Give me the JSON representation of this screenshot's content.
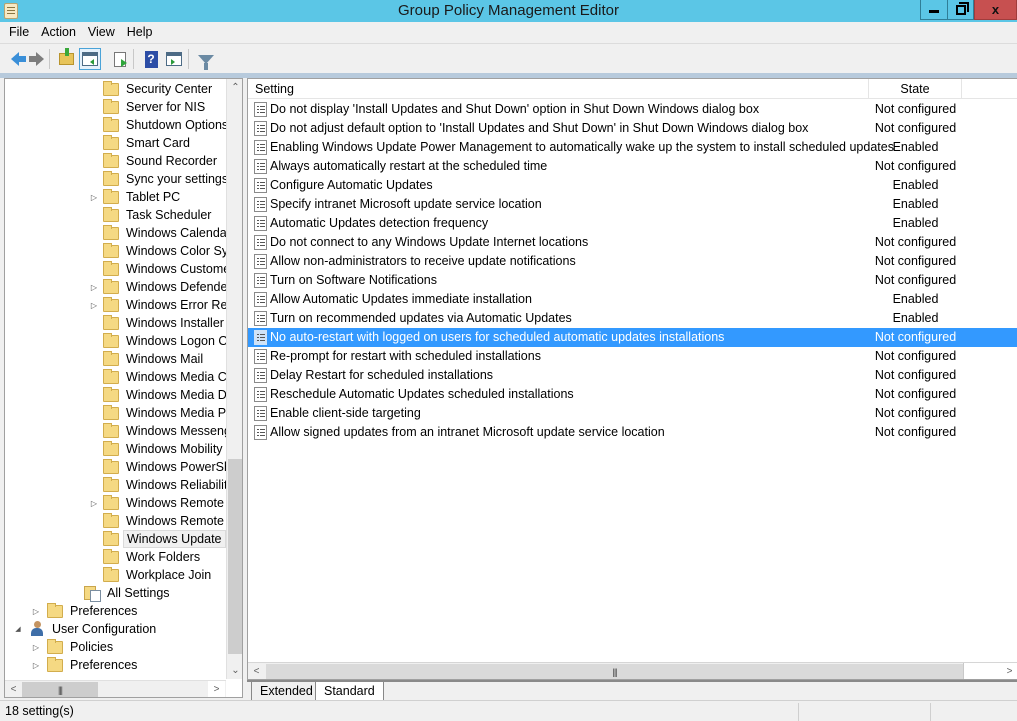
{
  "window": {
    "title": "Group Policy Management Editor",
    "controls": {
      "minimize": "minimize",
      "restore": "restore",
      "close": "x"
    }
  },
  "menu": [
    "File",
    "Action",
    "View",
    "Help"
  ],
  "toolbar": {
    "buttons": [
      "back-icon",
      "forward-icon",
      "up-one-level-icon",
      "show-hide-console-tree-icon",
      "export-list-icon",
      "help-icon",
      "show-hide-action-pane-icon",
      "filter-icon"
    ]
  },
  "tree": {
    "items": [
      {
        "label": "Security Center",
        "icon": "folder",
        "expander": false
      },
      {
        "label": "Server for NIS",
        "icon": "folder",
        "expander": false
      },
      {
        "label": "Shutdown Options",
        "icon": "folder",
        "expander": false
      },
      {
        "label": "Smart Card",
        "icon": "folder",
        "expander": false
      },
      {
        "label": "Sound Recorder",
        "icon": "folder",
        "expander": false
      },
      {
        "label": "Sync your settings",
        "icon": "folder",
        "expander": false
      },
      {
        "label": "Tablet PC",
        "icon": "folder",
        "expander": true
      },
      {
        "label": "Task Scheduler",
        "icon": "folder",
        "expander": false
      },
      {
        "label": "Windows Calendar",
        "icon": "folder",
        "expander": false
      },
      {
        "label": "Windows Color Sys",
        "icon": "folder",
        "expander": false
      },
      {
        "label": "Windows Custome",
        "icon": "folder",
        "expander": false
      },
      {
        "label": "Windows Defender",
        "icon": "folder",
        "expander": true
      },
      {
        "label": "Windows Error Rep",
        "icon": "folder",
        "expander": true
      },
      {
        "label": "Windows Installer",
        "icon": "folder",
        "expander": false
      },
      {
        "label": "Windows Logon Op",
        "icon": "folder",
        "expander": false
      },
      {
        "label": "Windows Mail",
        "icon": "folder",
        "expander": false
      },
      {
        "label": "Windows Media Ce",
        "icon": "folder",
        "expander": false
      },
      {
        "label": "Windows Media Di",
        "icon": "folder",
        "expander": false
      },
      {
        "label": "Windows Media Pla",
        "icon": "folder",
        "expander": false
      },
      {
        "label": "Windows Messeng",
        "icon": "folder",
        "expander": false
      },
      {
        "label": "Windows Mobility",
        "icon": "folder",
        "expander": false
      },
      {
        "label": "Windows PowerShe",
        "icon": "folder",
        "expander": false
      },
      {
        "label": "Windows Reliability",
        "icon": "folder",
        "expander": false
      },
      {
        "label": "Windows Remote M",
        "icon": "folder",
        "expander": true
      },
      {
        "label": "Windows Remote S",
        "icon": "folder",
        "expander": false
      },
      {
        "label": "Windows Update",
        "icon": "folder",
        "expander": false,
        "selected": true
      },
      {
        "label": "Work Folders",
        "icon": "folder",
        "expander": false
      },
      {
        "label": "Workplace Join",
        "icon": "folder",
        "expander": false
      }
    ],
    "all_settings": "All Settings",
    "preferences_1": "Preferences",
    "user_configuration": "User Configuration",
    "policies": "Policies",
    "preferences_2": "Preferences"
  },
  "list": {
    "columns": {
      "setting": "Setting",
      "state": "State"
    },
    "rows": [
      {
        "name": "Do not display 'Install Updates and Shut Down' option in Shut Down Windows dialog box",
        "state": "Not configured"
      },
      {
        "name": "Do not adjust default option to 'Install Updates and Shut Down' in Shut Down Windows dialog box",
        "state": "Not configured"
      },
      {
        "name": "Enabling Windows Update Power Management to automatically wake up the system to install scheduled updates",
        "state": "Enabled"
      },
      {
        "name": "Always automatically restart at the scheduled time",
        "state": "Not configured"
      },
      {
        "name": "Configure Automatic Updates",
        "state": "Enabled"
      },
      {
        "name": "Specify intranet Microsoft update service location",
        "state": "Enabled"
      },
      {
        "name": "Automatic Updates detection frequency",
        "state": "Enabled"
      },
      {
        "name": "Do not connect to any Windows Update Internet locations",
        "state": "Not configured"
      },
      {
        "name": "Allow non-administrators to receive update notifications",
        "state": "Not configured"
      },
      {
        "name": "Turn on Software Notifications",
        "state": "Not configured"
      },
      {
        "name": "Allow Automatic Updates immediate installation",
        "state": "Enabled"
      },
      {
        "name": "Turn on recommended updates via Automatic Updates",
        "state": "Enabled"
      },
      {
        "name": "No auto-restart with logged on users for scheduled automatic updates installations",
        "state": "Not configured",
        "selected": true
      },
      {
        "name": "Re-prompt for restart with scheduled installations",
        "state": "Not configured"
      },
      {
        "name": "Delay Restart for scheduled installations",
        "state": "Not configured"
      },
      {
        "name": "Reschedule Automatic Updates scheduled installations",
        "state": "Not configured"
      },
      {
        "name": "Enable client-side targeting",
        "state": "Not configured"
      },
      {
        "name": "Allow signed updates from an intranet Microsoft update service location",
        "state": "Not configured"
      }
    ]
  },
  "tabs": [
    "Extended",
    "Standard"
  ],
  "active_tab": "Standard",
  "status": {
    "text": "18 setting(s)"
  },
  "colors": {
    "titlebar": "#5bc6e6",
    "close": "#c75050",
    "selection": "#3399ff"
  }
}
